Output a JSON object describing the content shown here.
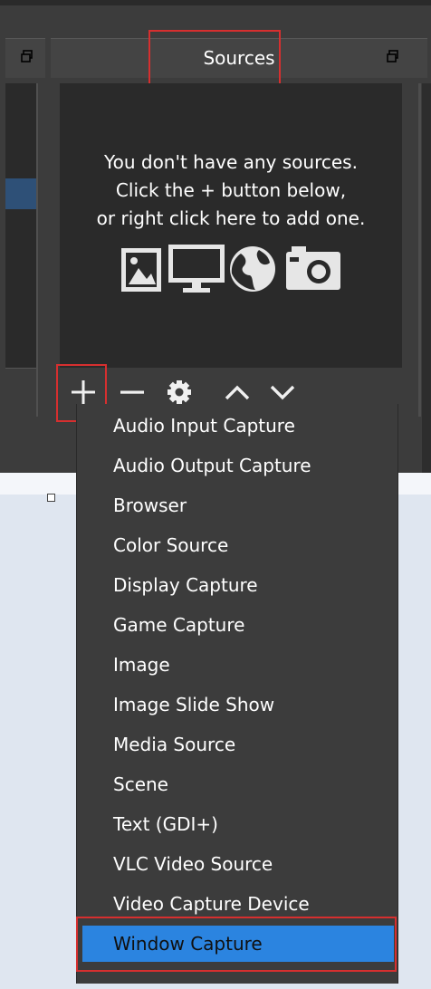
{
  "sources_dock": {
    "title": "Sources",
    "empty_message": "You don't have any sources.\nClick the + button below,\nor right click here to add one.",
    "empty_icons": [
      "image-icon",
      "monitor-icon",
      "globe-icon",
      "camera-icon"
    ],
    "toolbar": [
      "add-icon",
      "remove-icon",
      "gear-icon",
      "arrow-up-icon",
      "arrow-down-icon"
    ]
  },
  "add_menu": {
    "items": [
      "Audio Input Capture",
      "Audio Output Capture",
      "Browser",
      "Color Source",
      "Display Capture",
      "Game Capture",
      "Image",
      "Image Slide Show",
      "Media Source",
      "Scene",
      "Text (GDI+)",
      "VLC Video Source",
      "Video Capture Device",
      "Window Capture"
    ],
    "selected": "Window Capture"
  },
  "colors": {
    "dock_bg": "#3c3c3c",
    "list_bg": "#2a2a2a",
    "highlight": "#d62f2f",
    "selection": "#2b84e0"
  }
}
